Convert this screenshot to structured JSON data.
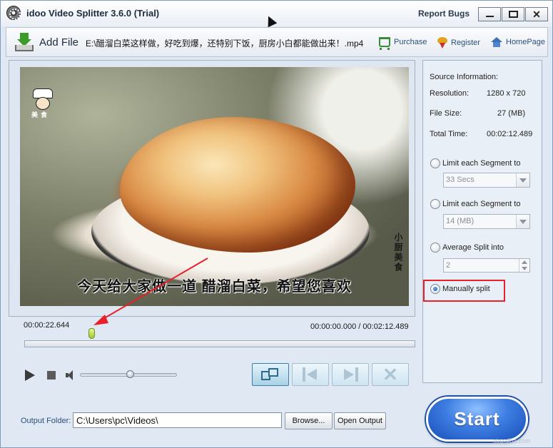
{
  "window": {
    "title": "idoo Video Splitter 3.6.0 (Trial)",
    "report_bugs": "Report Bugs",
    "controls": {
      "minimize": "minimize-icon",
      "maximize": "maximize-icon",
      "close": "✕"
    }
  },
  "toolbar": {
    "add_file": "Add File",
    "file_path": "E:\\醋溜白菜这样做，好吃到爆，还特别下饭，厨房小白都能做出来！.mp4",
    "purchase": "Purchase",
    "register": "Register",
    "homepage": "HomePage"
  },
  "video": {
    "subtitle": "今天给大家做一道 醋溜白菜，希望您喜欢",
    "logo_text": "美食",
    "watermark": "小厨美食"
  },
  "timeline": {
    "current_time": "00:00:22.644",
    "range_text": "00:00:00.000 / 00:02:12.489",
    "marker_position_fraction": 0.171
  },
  "playback": {
    "volume_fraction": 0.48,
    "buttons": [
      "split",
      "previous",
      "next",
      "delete"
    ]
  },
  "info": {
    "header": "Source Information:",
    "resolution_label": "Resolution:",
    "resolution_value": "1280 x 720",
    "filesize_label": "File Size:",
    "filesize_value": "27 (MB)",
    "totaltime_label": "Total Time:",
    "totaltime_value": "00:02:12.489"
  },
  "split_options": {
    "option1_label": "Limit each Segment to",
    "option1_value": "33 Secs",
    "option2_label": "Limit each Segment to",
    "option2_value": "14 (MB)",
    "option3_label": "Average Split into",
    "option3_value": "2",
    "option4_label": "Manually split",
    "selected": "Manually split"
  },
  "output": {
    "label": "Output Folder:",
    "path": "C:\\Users\\pc\\Videos\\",
    "browse": "Browse...",
    "open_output": "Open Output"
  },
  "start_label": "Start",
  "site_watermark": "xiazaiba.com",
  "colors": {
    "accent": "#2e6bd2",
    "annotation_red": "#e8202a",
    "panel_bg": "#dfe8f3"
  }
}
